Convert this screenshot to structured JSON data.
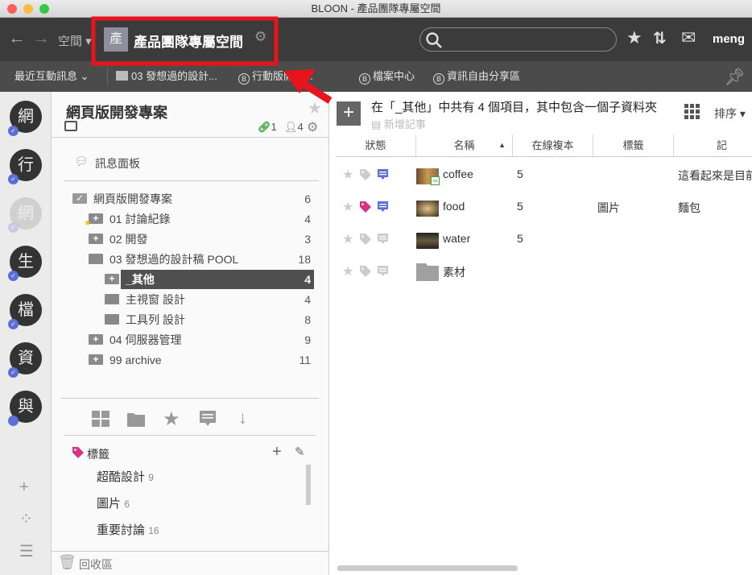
{
  "window": {
    "title": "BLOON - 產品團隊專屬空間"
  },
  "toolbar": {
    "spaces_label": "空間",
    "space_avatar": "產",
    "space_name": "產品團隊專屬空間",
    "search_placeholder": "",
    "user": "meng"
  },
  "bookmarks": {
    "recent": "最近互動訊息",
    "items": [
      "03 發想過的設計...",
      "行動版開發...",
      "檔案中心",
      "資訊自由分享區"
    ],
    "badge": "B"
  },
  "rail": {
    "avatars": [
      {
        "char": "網",
        "faded": false
      },
      {
        "char": "行",
        "faded": false
      },
      {
        "char": "網",
        "faded": true
      },
      {
        "char": "生",
        "faded": false
      },
      {
        "char": "檔",
        "faded": false
      },
      {
        "char": "資",
        "faded": false
      },
      {
        "char": "與",
        "faded": false
      }
    ]
  },
  "sidebar": {
    "project_title": "網頁版開發專案",
    "links_count": "1",
    "members_count": "4",
    "message_board": "訊息面板",
    "tree": [
      {
        "label": "網頁版開發專案",
        "count": "6",
        "level": 0,
        "icon": "folder-check-icon"
      },
      {
        "label": "01 討論紀錄",
        "count": "4",
        "level": 1,
        "icon": "folder-plus-icon",
        "starred": true
      },
      {
        "label": "02 開發",
        "count": "3",
        "level": 1,
        "icon": "folder-plus-icon"
      },
      {
        "label": "03 發想過的設計稿 POOL",
        "count": "18",
        "level": 1,
        "icon": "folder-open-icon"
      },
      {
        "label": "_其他",
        "count": "4",
        "level": 2,
        "icon": "folder-plus-icon",
        "selected": true
      },
      {
        "label": "主視窗 設計",
        "count": "4",
        "level": 2,
        "icon": "folder-icon"
      },
      {
        "label": "工具列 設計",
        "count": "8",
        "level": 2,
        "icon": "folder-icon"
      },
      {
        "label": "04 伺服器管理",
        "count": "9",
        "level": 1,
        "icon": "folder-plus-icon"
      },
      {
        "label": "99 archive",
        "count": "11",
        "level": 1,
        "icon": "folder-plus-icon"
      }
    ],
    "tags_title": "標籤",
    "tags": [
      {
        "name": "超酷設計",
        "count": "9"
      },
      {
        "name": "圖片",
        "count": "6"
      },
      {
        "name": "重要討論",
        "count": "16"
      }
    ],
    "trash": "回收區"
  },
  "main": {
    "summary": "在「_其他」中共有 4 個項目，其中包含一個子資料夾",
    "add_note": "新增記事",
    "sort_label": "排序",
    "columns": [
      "狀態",
      "名稱",
      "在線複本",
      "標籤",
      "記"
    ],
    "rows": [
      {
        "name": "coffee",
        "copies": "5",
        "tag": "",
        "note": "這看起來是目前",
        "tagged": false,
        "has_note": true,
        "type": "image"
      },
      {
        "name": "food",
        "copies": "5",
        "tag": "圖片",
        "note": "麵包",
        "tagged": true,
        "has_note": true,
        "type": "image"
      },
      {
        "name": "water",
        "copies": "5",
        "tag": "",
        "note": "",
        "tagged": false,
        "has_note": false,
        "type": "image"
      },
      {
        "name": "素材",
        "copies": "",
        "tag": "",
        "note": "",
        "tagged": false,
        "has_note": false,
        "type": "folder"
      }
    ]
  },
  "colors": {
    "accent": "#5b6fd6",
    "tag_pink": "#d63384",
    "link_green": "#3aa53a",
    "annotation": "#e8141b",
    "toolbar": "#3b3b3b"
  }
}
